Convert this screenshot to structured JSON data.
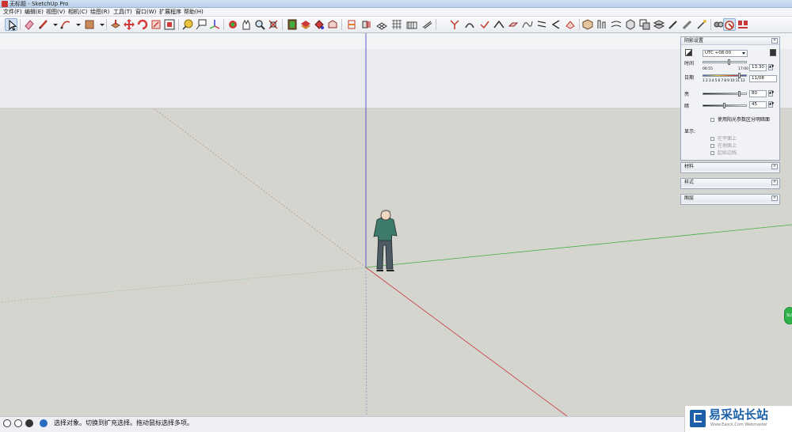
{
  "window": {
    "title": "无标题 - SketchUp Pro"
  },
  "menu": [
    "文件(F)",
    "编辑(E)",
    "视图(V)",
    "相机(C)",
    "绘图(R)",
    "工具(T)",
    "窗口(W)",
    "扩展程序",
    "帮助(H)"
  ],
  "toolbar": {
    "tools": [
      "select-icon",
      "eraser-icon",
      "pencil-icon",
      "dropdown-arrow-icon",
      "arc-icon",
      "dropdown-arrow-icon",
      "rectangle-icon",
      "dropdown-arrow-icon",
      "push-pull-icon",
      "move-icon",
      "rotate-icon",
      "scale-icon",
      "offset-icon",
      "tape-measure-icon",
      "text-icon",
      "axes-icon",
      "orbit-icon",
      "pan-icon",
      "zoom-icon",
      "zoom-extents-icon",
      "components-icon",
      "materials-icon",
      "paint-icon",
      "warehouse-icon",
      "section-icon"
    ]
  },
  "colors": {
    "sky": "#e9ebee",
    "ground": "#d5d5d0",
    "axis_red": "#c8373a",
    "axis_green": "#3fae3f",
    "axis_blue": "#3a3ac8",
    "accent": "#1a5fa8"
  },
  "shadow_panel": {
    "title": "阴影设置",
    "timezone": "UTC +08:00",
    "time_label": "时间",
    "time_start": "06:55",
    "time_end": "17:00",
    "time_value": "13:30",
    "date_label": "日期",
    "months": "1 2 3 4 5 6 7 8 9 10 11 12",
    "date_value": "11/08",
    "light_label": "亮",
    "light_value": "80",
    "dark_label": "暗",
    "dark_value": "45",
    "sun_for_shading": "使用阳光参数区分明暗面",
    "display_label": "显示:",
    "on_faces": "在平面上",
    "on_ground": "在地面上",
    "from_edges": "起始边线"
  },
  "panels": [
    {
      "title": "材料"
    },
    {
      "title": "样式"
    },
    {
      "title": "图层"
    }
  ],
  "status": {
    "text": "选择对象。切换到扩充选择。拖动鼠标选择多项。"
  },
  "watermark": {
    "text": "易采站长站",
    "sub": "Www.Easck.Com Webmaster"
  },
  "side_tab": {
    "label": "SU"
  }
}
